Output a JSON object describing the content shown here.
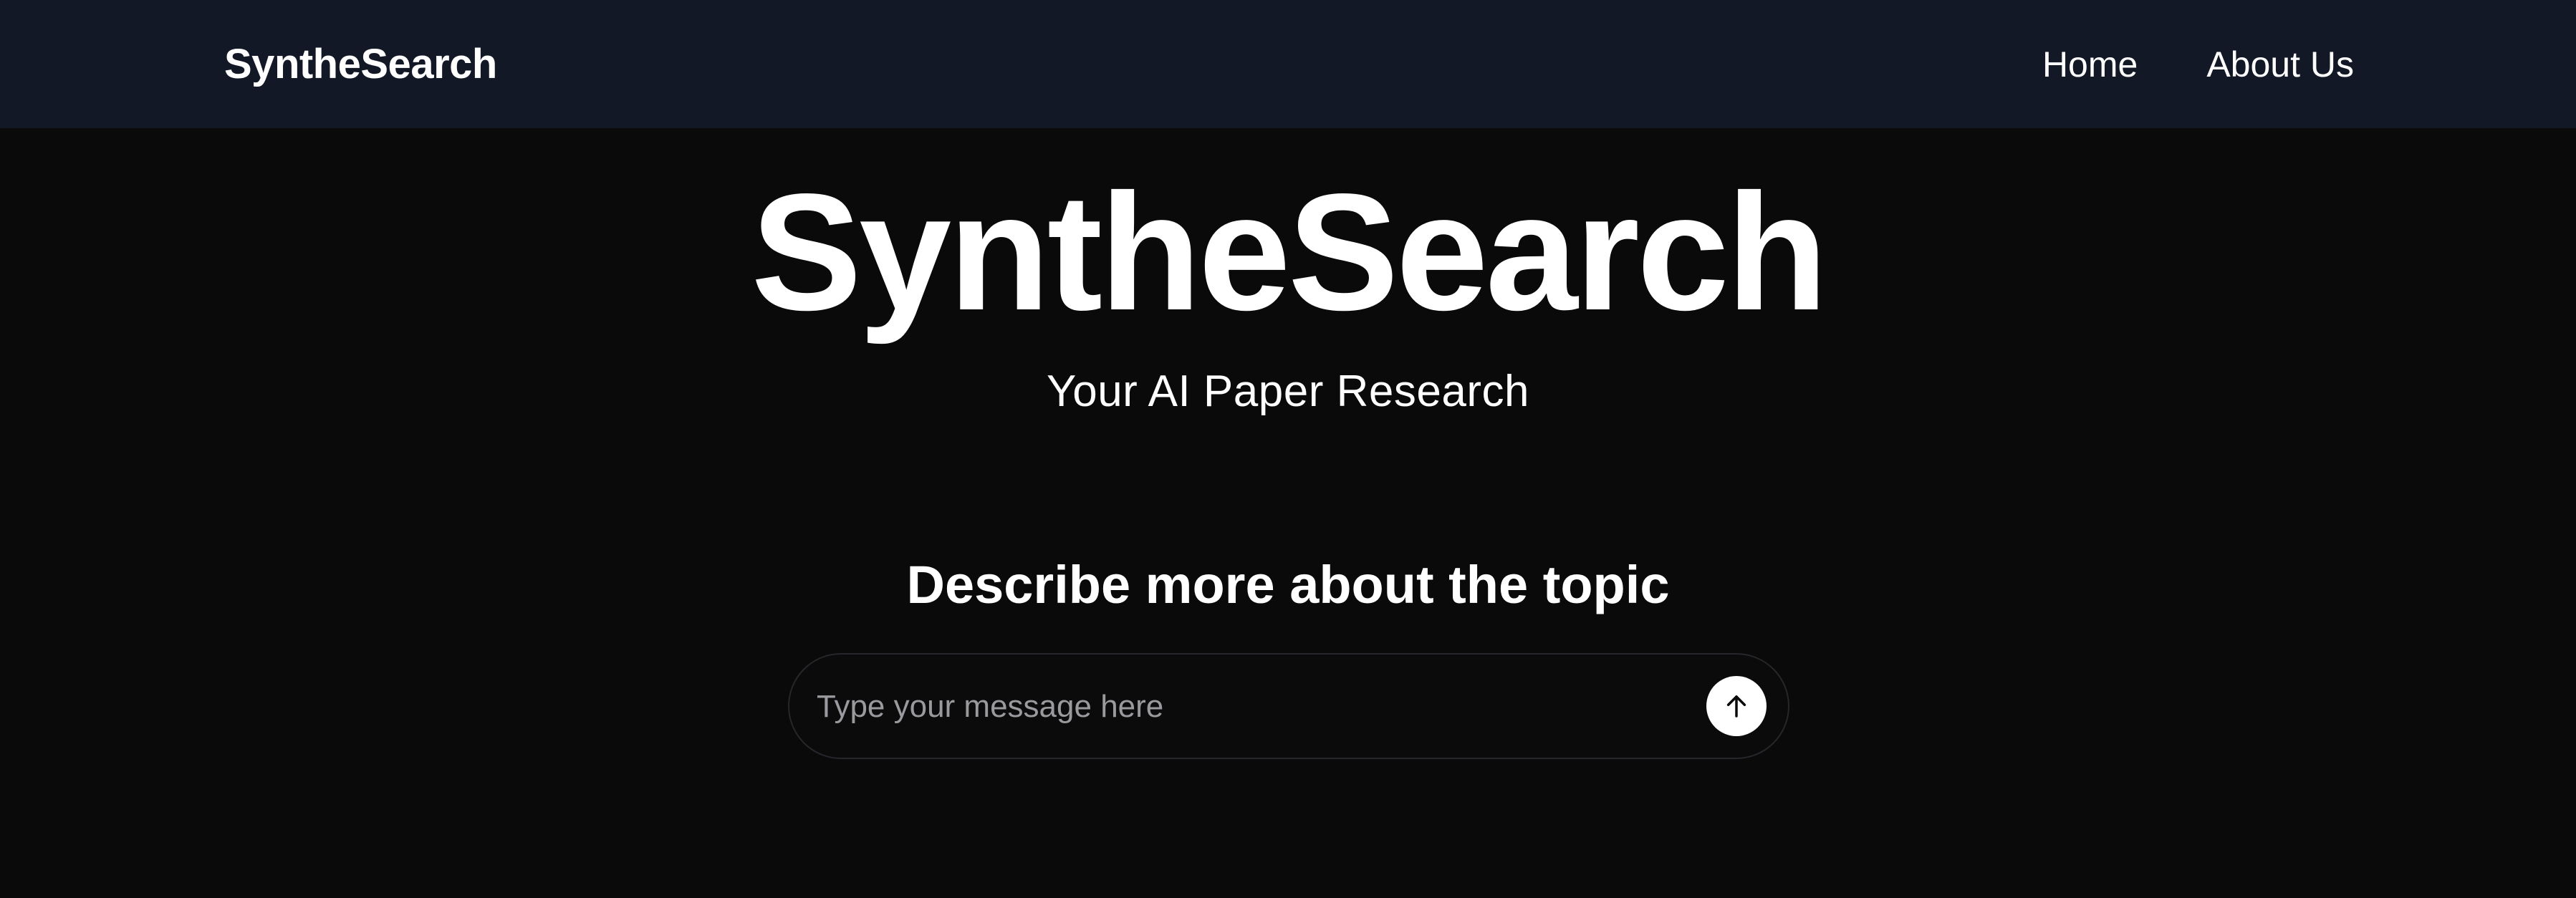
{
  "navbar": {
    "brand": "SyntheSearch",
    "links": [
      {
        "label": "Home"
      },
      {
        "label": "About Us"
      }
    ]
  },
  "hero": {
    "title": "SyntheSearch",
    "subtitle": "Your AI Paper Research"
  },
  "prompt": {
    "heading": "Describe more about the topic",
    "input_placeholder": "Type your message here",
    "input_value": "",
    "send_icon": "arrow-up-icon"
  },
  "colors": {
    "navbar_bg": "#131826",
    "page_bg": "#0a0a0b",
    "text": "#ffffff",
    "placeholder": "#9a9a9e",
    "input_border": "#26272b",
    "send_button_bg": "#ffffff"
  }
}
